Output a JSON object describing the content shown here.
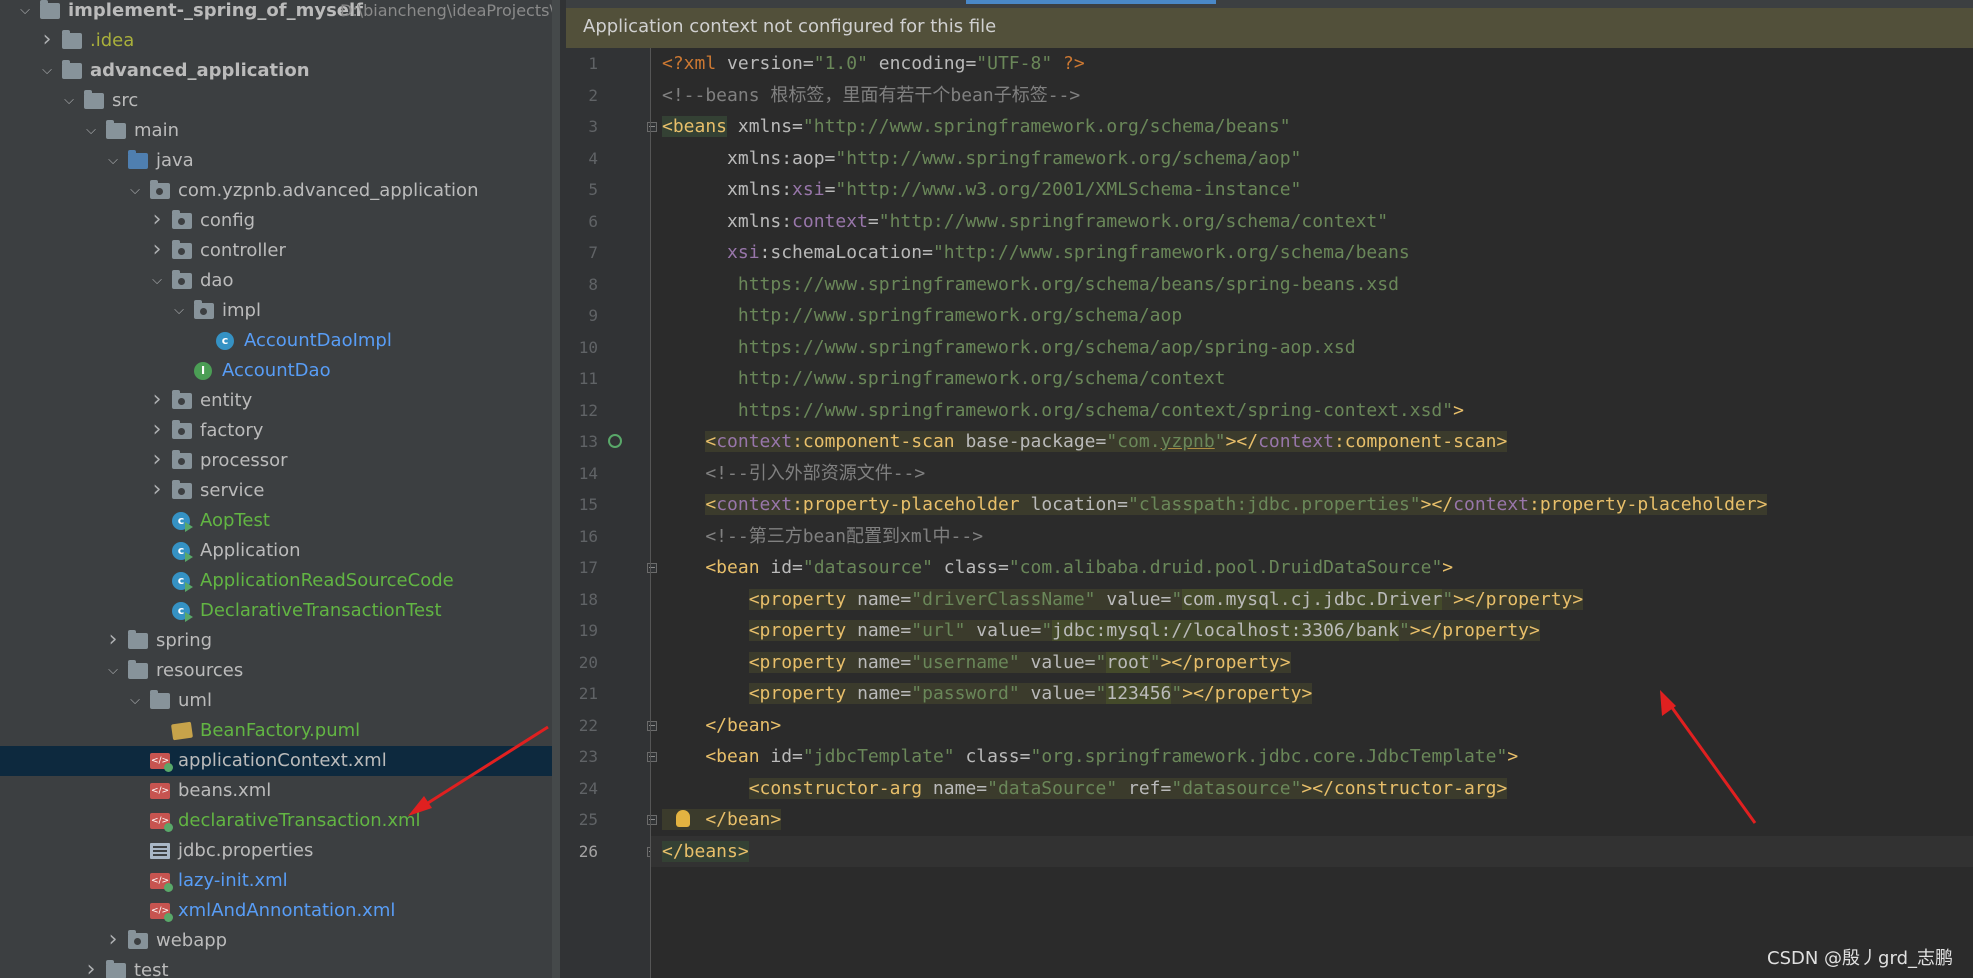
{
  "tree": {
    "items": [
      {
        "label": "implement-_spring_of_myself",
        "hint": "D:\\biancheng\\ideaProjects\\i",
        "depth": 0,
        "arrow": "open",
        "icon": "module",
        "color": "gray",
        "bold": true
      },
      {
        "label": ".idea",
        "depth": 1,
        "arrow": "closed",
        "icon": "folder",
        "color": "yellow"
      },
      {
        "label": "advanced_application",
        "depth": 1,
        "arrow": "open",
        "icon": "module",
        "color": "gray",
        "bold": true
      },
      {
        "label": "src",
        "depth": 2,
        "arrow": "open",
        "icon": "folder",
        "color": "gray"
      },
      {
        "label": "main",
        "depth": 3,
        "arrow": "open",
        "icon": "folder",
        "color": "gray"
      },
      {
        "label": "java",
        "depth": 4,
        "arrow": "open",
        "icon": "src",
        "color": "gray"
      },
      {
        "label": "com.yzpnb.advanced_application",
        "depth": 5,
        "arrow": "open",
        "icon": "pkg",
        "color": "gray"
      },
      {
        "label": "config",
        "depth": 6,
        "arrow": "closed",
        "icon": "pkg",
        "color": "gray"
      },
      {
        "label": "controller",
        "depth": 6,
        "arrow": "closed",
        "icon": "pkg",
        "color": "gray"
      },
      {
        "label": "dao",
        "depth": 6,
        "arrow": "open",
        "icon": "pkg",
        "color": "gray"
      },
      {
        "label": "impl",
        "depth": 7,
        "arrow": "open",
        "icon": "pkg",
        "color": "gray"
      },
      {
        "label": "AccountDaoImpl",
        "depth": 8,
        "arrow": "none",
        "icon": "class",
        "color": "blue"
      },
      {
        "label": "AccountDao",
        "depth": 7,
        "arrow": "none",
        "icon": "interface",
        "color": "blue"
      },
      {
        "label": "entity",
        "depth": 6,
        "arrow": "closed",
        "icon": "pkg",
        "color": "gray"
      },
      {
        "label": "factory",
        "depth": 6,
        "arrow": "closed",
        "icon": "pkg",
        "color": "gray"
      },
      {
        "label": "processor",
        "depth": 6,
        "arrow": "closed",
        "icon": "pkg",
        "color": "gray"
      },
      {
        "label": "service",
        "depth": 6,
        "arrow": "closed",
        "icon": "pkg",
        "color": "gray"
      },
      {
        "label": "AopTest",
        "depth": 6,
        "arrow": "none",
        "icon": "runclass",
        "color": "green"
      },
      {
        "label": "Application",
        "depth": 6,
        "arrow": "none",
        "icon": "runclass",
        "color": "gray"
      },
      {
        "label": "ApplicationReadSourceCode",
        "depth": 6,
        "arrow": "none",
        "icon": "runclass",
        "color": "green"
      },
      {
        "label": "DeclarativeTransactionTest",
        "depth": 6,
        "arrow": "none",
        "icon": "runclass",
        "color": "green"
      },
      {
        "label": "spring",
        "depth": 4,
        "arrow": "closed",
        "icon": "folder",
        "color": "gray"
      },
      {
        "label": "resources",
        "depth": 4,
        "arrow": "open",
        "icon": "folder",
        "color": "gray"
      },
      {
        "label": "uml",
        "depth": 5,
        "arrow": "open",
        "icon": "folder",
        "color": "gray"
      },
      {
        "label": "BeanFactory.puml",
        "depth": 6,
        "arrow": "none",
        "icon": "puml",
        "color": "green"
      },
      {
        "label": "applicationContext.xml",
        "depth": 5,
        "arrow": "none",
        "icon": "xml",
        "color": "gray",
        "selected": true
      },
      {
        "label": "beans.xml",
        "depth": 5,
        "arrow": "none",
        "icon": "xmlplain",
        "color": "gray"
      },
      {
        "label": "declarativeTransaction.xml",
        "depth": 5,
        "arrow": "none",
        "icon": "xml",
        "color": "green"
      },
      {
        "label": "jdbc.properties",
        "depth": 5,
        "arrow": "none",
        "icon": "props",
        "color": "gray"
      },
      {
        "label": "lazy-init.xml",
        "depth": 5,
        "arrow": "none",
        "icon": "xml",
        "color": "blue"
      },
      {
        "label": "xmlAndAnnontation.xml",
        "depth": 5,
        "arrow": "none",
        "icon": "xml",
        "color": "blue"
      },
      {
        "label": "webapp",
        "depth": 4,
        "arrow": "closed",
        "icon": "webfolder",
        "color": "gray"
      },
      {
        "label": "test",
        "depth": 3,
        "arrow": "closed",
        "icon": "folder",
        "color": "gray"
      }
    ]
  },
  "editor": {
    "banner": "Application context not configured for this file",
    "current_line": 26,
    "lines": [
      [
        [
          "pi",
          "<?xml "
        ],
        [
          "at",
          "version="
        ],
        [
          "v",
          "\"1.0\""
        ],
        [
          "at",
          " encoding="
        ],
        [
          "v",
          "\"UTF-8\""
        ],
        [
          "pi",
          " ?>"
        ]
      ],
      [
        [
          "cm",
          "<!--beans 根标签，里面有若干个bean子标签-->"
        ]
      ],
      [
        [
          "t bhl",
          "<beans"
        ],
        [
          "at",
          " xmlns="
        ],
        [
          "v",
          "\"http://www.springframework.org/schema/beans\""
        ]
      ],
      [
        [
          "at",
          "      xmlns:aop="
        ],
        [
          "v",
          "\"http://www.springframework.org/schema/aop\""
        ]
      ],
      [
        [
          "at",
          "      xmlns:"
        ],
        [
          "ns",
          "xsi"
        ],
        [
          "at",
          "="
        ],
        [
          "v",
          "\"http://www.w3.org/2001/XMLSchema-instance\""
        ]
      ],
      [
        [
          "at",
          "      xmlns:"
        ],
        [
          "ns",
          "context"
        ],
        [
          "at",
          "="
        ],
        [
          "v",
          "\"http://www.springframework.org/schema/context\""
        ]
      ],
      [
        [
          "ns",
          "      xsi"
        ],
        [
          "at",
          ":schemaLocation="
        ],
        [
          "v",
          "\"http://www.springframework.org/schema/beans"
        ]
      ],
      [
        [
          "v",
          "       https://www.springframework.org/schema/beans/spring-beans.xsd"
        ]
      ],
      [
        [
          "v",
          "       http://www.springframework.org/schema/aop"
        ]
      ],
      [
        [
          "v",
          "       https://www.springframework.org/schema/aop/spring-aop.xsd"
        ]
      ],
      [
        [
          "v",
          "       http://www.springframework.org/schema/context"
        ]
      ],
      [
        [
          "v",
          "       https://www.springframework.org/schema/context/spring-context.xsd\""
        ],
        [
          "t",
          ">"
        ]
      ],
      [
        [
          "",
          "    "
        ],
        [
          "t hl",
          "<"
        ],
        [
          "ns hl",
          "context"
        ],
        [
          "t hl",
          ":component-scan"
        ],
        [
          "at hl",
          " base-package="
        ],
        [
          "v hl",
          "\"com."
        ],
        [
          "v hl ul",
          "yzpnb"
        ],
        [
          "v hl",
          "\""
        ],
        [
          "t hl",
          "></"
        ],
        [
          "ns hl",
          "context"
        ],
        [
          "t hl",
          ":component-scan>"
        ]
      ],
      [
        [
          "cm",
          "    <!--引入外部资源文件-->"
        ]
      ],
      [
        [
          "",
          "    "
        ],
        [
          "t hl",
          "<"
        ],
        [
          "ns hl",
          "context"
        ],
        [
          "t hl",
          ":property-placeholder"
        ],
        [
          "at hl",
          " location="
        ],
        [
          "v hl",
          "\"classpath:jdbc.properties\""
        ],
        [
          "t hl",
          "></"
        ],
        [
          "ns hl",
          "context"
        ],
        [
          "t hl",
          ":property-placeholder>"
        ]
      ],
      [
        [
          "cm",
          "    <!--第三方bean配置到xml中-->"
        ]
      ],
      [
        [
          "t",
          "    <bean"
        ],
        [
          "at",
          " id="
        ],
        [
          "v",
          "\"datasource\""
        ],
        [
          "at",
          " class="
        ],
        [
          "v",
          "\"com.alibaba.druid.pool.DruidDataSource\""
        ],
        [
          "t",
          ">"
        ]
      ],
      [
        [
          "",
          "        "
        ],
        [
          "t hl",
          "<property"
        ],
        [
          "at hl",
          " name="
        ],
        [
          "v hl",
          "\"driverClassName\""
        ],
        [
          "at hl",
          " value="
        ],
        [
          "v hl",
          "\""
        ],
        [
          "at hl2",
          "com.mysql.cj.jdbc.Driver"
        ],
        [
          "v hl",
          "\""
        ],
        [
          "t hl",
          "></property>"
        ]
      ],
      [
        [
          "",
          "        "
        ],
        [
          "t hl",
          "<property"
        ],
        [
          "at hl",
          " name="
        ],
        [
          "v hl",
          "\"url\""
        ],
        [
          "at hl",
          " value="
        ],
        [
          "v hl",
          "\""
        ],
        [
          "at hl2",
          "jdbc:mysql://localhost:3306/bank"
        ],
        [
          "v hl",
          "\""
        ],
        [
          "t hl",
          "></property>"
        ]
      ],
      [
        [
          "",
          "        "
        ],
        [
          "t hl",
          "<property"
        ],
        [
          "at hl",
          " name="
        ],
        [
          "v hl",
          "\"username\""
        ],
        [
          "at hl",
          " value="
        ],
        [
          "v hl",
          "\""
        ],
        [
          "at hl2",
          "root"
        ],
        [
          "v hl",
          "\""
        ],
        [
          "t hl",
          "></property>"
        ]
      ],
      [
        [
          "",
          "        "
        ],
        [
          "t hl",
          "<property"
        ],
        [
          "at hl",
          " name="
        ],
        [
          "v hl",
          "\"password\""
        ],
        [
          "at hl",
          " value="
        ],
        [
          "v hl",
          "\""
        ],
        [
          "at hl2",
          "123456"
        ],
        [
          "v hl",
          "\""
        ],
        [
          "t hl",
          "></property>"
        ]
      ],
      [
        [
          "t",
          "    </bean>"
        ]
      ],
      [
        [
          "t",
          "    <bean"
        ],
        [
          "at",
          " id="
        ],
        [
          "v",
          "\"jdbcTemplate\""
        ],
        [
          "at",
          " class="
        ],
        [
          "v",
          "\"org.springframework.jdbc.core.JdbcTemplate\""
        ],
        [
          "t",
          ">"
        ]
      ],
      [
        [
          "",
          "        "
        ],
        [
          "t hl",
          "<constructor-arg"
        ],
        [
          "at hl",
          " name="
        ],
        [
          "v hl",
          "\"dataSource\""
        ],
        [
          "at hl",
          " ref="
        ],
        [
          "v hl",
          "\"datasource\""
        ],
        [
          "t hl",
          "></constructor-arg>"
        ]
      ],
      [
        [
          "t hl",
          "    </bean>"
        ]
      ],
      [
        [
          "t bhl",
          "</beans>"
        ]
      ]
    ]
  },
  "watermark": "CSDN @殷丿grd_志鹏",
  "colors": {
    "tag": "#e8bf6a",
    "string": "#6a8759",
    "comment": "#808080",
    "namespace": "#9876aa",
    "annotation_arrow": "#e02020"
  }
}
